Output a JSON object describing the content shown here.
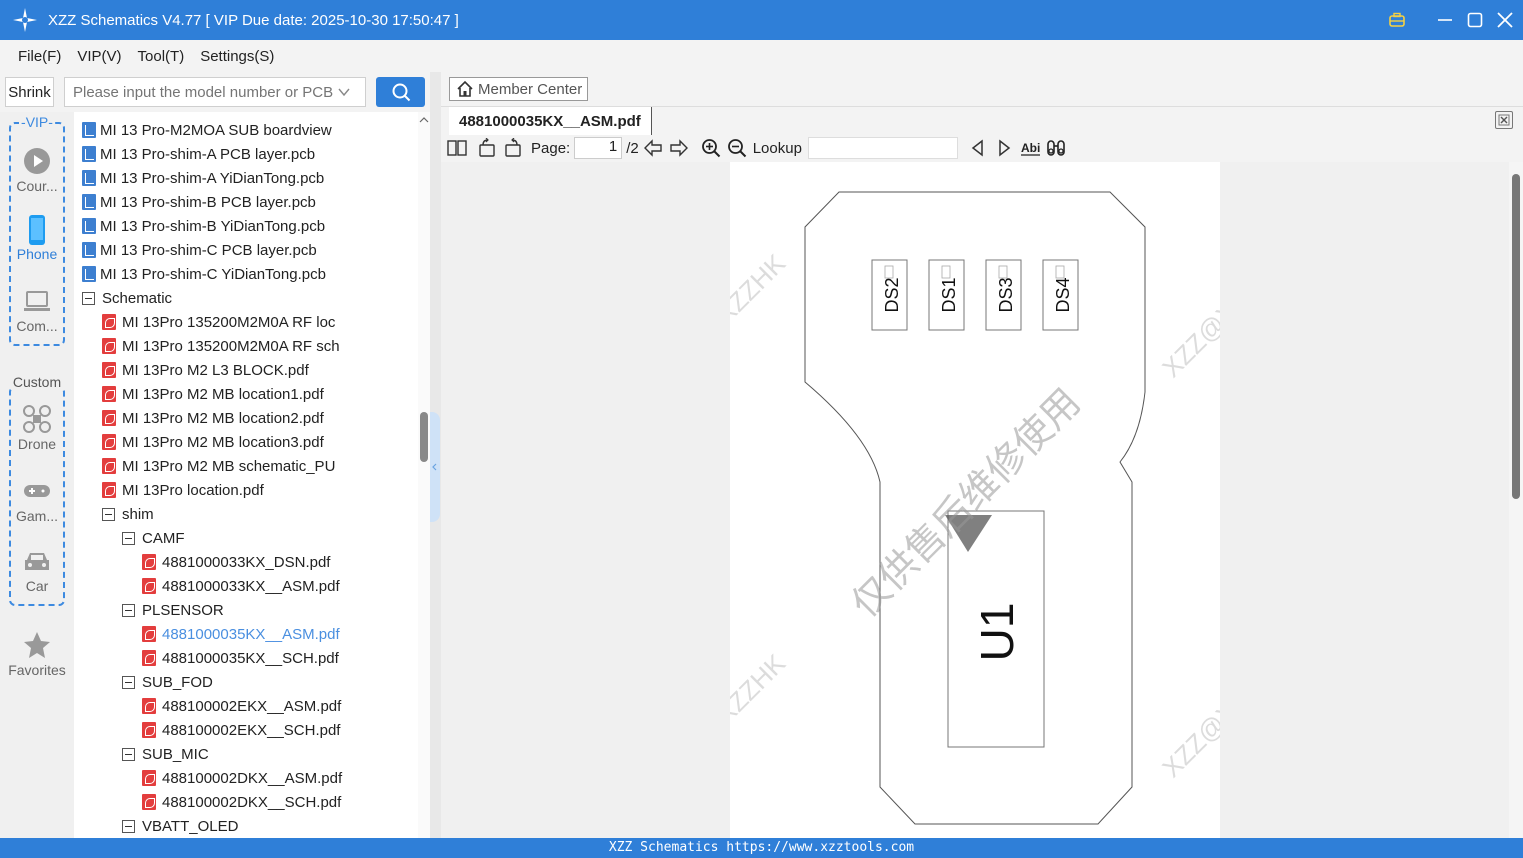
{
  "window": {
    "title": "XZZ Schematics V4.77 [ VIP Due date: 2025-10-30 17:50:47 ]"
  },
  "menu": [
    "File(F)",
    "VIP(V)",
    "Tool(T)",
    "Settings(S)"
  ],
  "search": {
    "shrink_label": "Shrink",
    "placeholder": "Please input the model number or PCB"
  },
  "sidebar": {
    "vip_label": "-VIP-",
    "custom_label": "Custom",
    "items": [
      {
        "label": "Cour...",
        "icon": "play-icon"
      },
      {
        "label": "Phone",
        "icon": "phone-icon",
        "active": true
      },
      {
        "label": "Com...",
        "icon": "laptop-icon"
      },
      {
        "label": "Drone",
        "icon": "drone-icon"
      },
      {
        "label": "Gam...",
        "icon": "gamepad-icon"
      },
      {
        "label": "Car",
        "icon": "car-icon"
      },
      {
        "label": "Favorites",
        "icon": "star-icon"
      }
    ]
  },
  "tree": [
    {
      "label": "MI 13 Pro-M2MOA SUB boardview",
      "icon": "pcb",
      "indent": 0
    },
    {
      "label": "MI 13 Pro-shim-A PCB layer.pcb",
      "icon": "pcb",
      "indent": 0
    },
    {
      "label": "MI 13 Pro-shim-A YiDianTong.pcb",
      "icon": "pcb",
      "indent": 0
    },
    {
      "label": "MI 13 Pro-shim-B PCB layer.pcb",
      "icon": "pcb",
      "indent": 0
    },
    {
      "label": "MI 13 Pro-shim-B YiDianTong.pcb",
      "icon": "pcb",
      "indent": 0
    },
    {
      "label": "MI 13 Pro-shim-C PCB layer.pcb",
      "icon": "pcb",
      "indent": 0
    },
    {
      "label": "MI 13 Pro-shim-C YiDianTong.pcb",
      "icon": "pcb",
      "indent": 0
    },
    {
      "label": "Schematic",
      "icon": "folder",
      "indent": 0
    },
    {
      "label": "MI 13Pro 135200M2M0A RF loc",
      "icon": "pdf",
      "indent": 1
    },
    {
      "label": "MI 13Pro 135200M2M0A RF sch",
      "icon": "pdf",
      "indent": 1
    },
    {
      "label": "MI 13Pro M2 L3 BLOCK.pdf",
      "icon": "pdf",
      "indent": 1
    },
    {
      "label": "MI 13Pro M2 MB location1.pdf",
      "icon": "pdf",
      "indent": 1
    },
    {
      "label": "MI 13Pro M2 MB location2.pdf",
      "icon": "pdf",
      "indent": 1
    },
    {
      "label": "MI 13Pro M2 MB location3.pdf",
      "icon": "pdf",
      "indent": 1
    },
    {
      "label": "MI 13Pro M2 MB schematic_PU",
      "icon": "pdf",
      "indent": 1
    },
    {
      "label": "MI 13Pro location.pdf",
      "icon": "pdf",
      "indent": 1
    },
    {
      "label": "shim",
      "icon": "folder",
      "indent": 1
    },
    {
      "label": "CAMF",
      "icon": "folder",
      "indent": 2
    },
    {
      "label": "4881000033KX_DSN.pdf",
      "icon": "pdf",
      "indent": 3
    },
    {
      "label": "4881000033KX__ASM.pdf",
      "icon": "pdf",
      "indent": 3
    },
    {
      "label": "PLSENSOR",
      "icon": "folder",
      "indent": 2
    },
    {
      "label": "4881000035KX__ASM.pdf",
      "icon": "pdf",
      "indent": 3,
      "selected": true
    },
    {
      "label": "4881000035KX__SCH.pdf",
      "icon": "pdf",
      "indent": 3
    },
    {
      "label": "SUB_FOD",
      "icon": "folder",
      "indent": 2
    },
    {
      "label": "488100002EKX__ASM.pdf",
      "icon": "pdf",
      "indent": 3
    },
    {
      "label": "488100002EKX__SCH.pdf",
      "icon": "pdf",
      "indent": 3
    },
    {
      "label": "SUB_MIC",
      "icon": "folder",
      "indent": 2
    },
    {
      "label": "488100002DKX__ASM.pdf",
      "icon": "pdf",
      "indent": 3
    },
    {
      "label": "488100002DKX__SCH.pdf",
      "icon": "pdf",
      "indent": 3
    },
    {
      "label": "VBATT_OLED",
      "icon": "folder",
      "indent": 2
    }
  ],
  "viewer": {
    "member_center": "Member Center",
    "tab_title": "4881000035KX__ASM.pdf",
    "page_label": "Page:",
    "page_current": "1",
    "page_total": "/2",
    "lookup_label": "Lookup"
  },
  "document": {
    "components": [
      "DS2",
      "DS1",
      "DS3",
      "DS4"
    ],
    "main_component": "U1",
    "watermark_cn": "仅供售后维修使用",
    "watermark_en": "XZZ@XZZHK"
  },
  "status": {
    "text": "XZZ Schematics https://www.xzztools.com"
  },
  "colors": {
    "accent": "#2f7fd8",
    "pdf_icon": "#e33d3d",
    "pcb_icon": "#3d7fd0",
    "selected_text": "#4a8fe0"
  }
}
